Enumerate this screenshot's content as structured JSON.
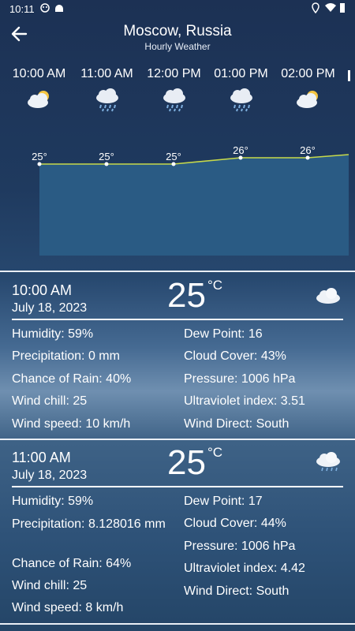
{
  "status_bar": {
    "time": "10:11"
  },
  "header": {
    "title": "Moscow, Russia",
    "subtitle": "Hourly Weather",
    "back_icon": "arrow-left-icon"
  },
  "hourly": [
    {
      "time": "10:00 AM",
      "icon": "partly-cloudy-icon"
    },
    {
      "time": "11:00 AM",
      "icon": "rain-cloud-icon"
    },
    {
      "time": "12:00 PM",
      "icon": "rain-cloud-icon"
    },
    {
      "time": "01:00 PM",
      "icon": "rain-cloud-icon"
    },
    {
      "time": "02:00 PM",
      "icon": "partly-cloudy-icon"
    }
  ],
  "chart_data": {
    "type": "area",
    "categories": [
      "10:00 AM",
      "11:00 AM",
      "12:00 PM",
      "01:00 PM",
      "02:00 PM"
    ],
    "values": [
      25,
      25,
      25,
      26,
      26
    ],
    "labels": [
      "25°",
      "25°",
      "25°",
      "26°",
      "26°"
    ],
    "colors": {
      "line": "#c7d94a",
      "fill": "#2a5b84"
    }
  },
  "details": [
    {
      "time": "10:00 AM",
      "date": "July 18, 2023",
      "temp": "25",
      "unit": "°C",
      "icon": "partly-cloudy-icon",
      "left": [
        "Humidity: 59%",
        "Precipitation: 0 mm",
        "Chance of Rain: 40%",
        "Wind chill: 25",
        "Wind speed: 10 km/h"
      ],
      "right": [
        "Dew Point: 16",
        "Cloud Cover: 43%",
        "Pressure: 1006 hPa",
        "Ultraviolet index: 3.51",
        "Wind Direct: South"
      ]
    },
    {
      "time": "11:00 AM",
      "date": "July 18, 2023",
      "temp": "25",
      "unit": "°C",
      "icon": "rain-cloud-icon",
      "left": [
        "Humidity: 59%",
        "Precipitation: 8.128016 mm",
        "Chance of Rain: 64%",
        "Wind chill: 25",
        "Wind speed: 8 km/h"
      ],
      "right": [
        "Dew Point: 17",
        "Cloud Cover: 44%",
        "Pressure: 1006 hPa",
        "Ultraviolet index: 4.42",
        "Wind Direct: South"
      ]
    }
  ]
}
